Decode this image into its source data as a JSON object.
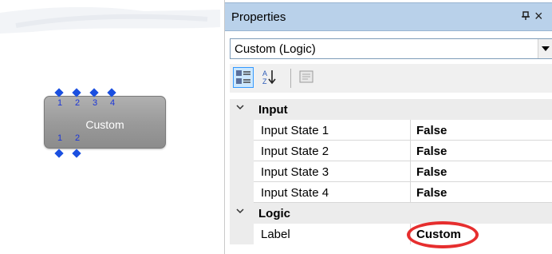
{
  "canvas": {
    "block": {
      "label": "Custom",
      "top_pins": [
        "1",
        "2",
        "3",
        "4"
      ],
      "bottom_pins": [
        "1",
        "2"
      ],
      "pin_color": "#1a4fe0"
    }
  },
  "panel": {
    "title": "Properties",
    "pin_icon_glyph": "1",
    "close_glyph": "×",
    "object_selector": {
      "value": "Custom (Logic)"
    },
    "toolbar": {
      "buttons": [
        "categorized-view-icon",
        "alphabetical-sort-icon",
        "property-pages-icon"
      ]
    },
    "categories": [
      {
        "label": "Input",
        "expanded": true,
        "properties": [
          {
            "name": "Input State 1",
            "value": "False"
          },
          {
            "name": "Input State 2",
            "value": "False"
          },
          {
            "name": "Input State 3",
            "value": "False"
          },
          {
            "name": "Input State 4",
            "value": "False"
          }
        ]
      },
      {
        "label": "Logic",
        "expanded": true,
        "properties": [
          {
            "name": "Label",
            "value": "Custom"
          }
        ]
      }
    ],
    "highlight_color": "#e62e2e",
    "title_bar_color": "#b9d1ea"
  }
}
